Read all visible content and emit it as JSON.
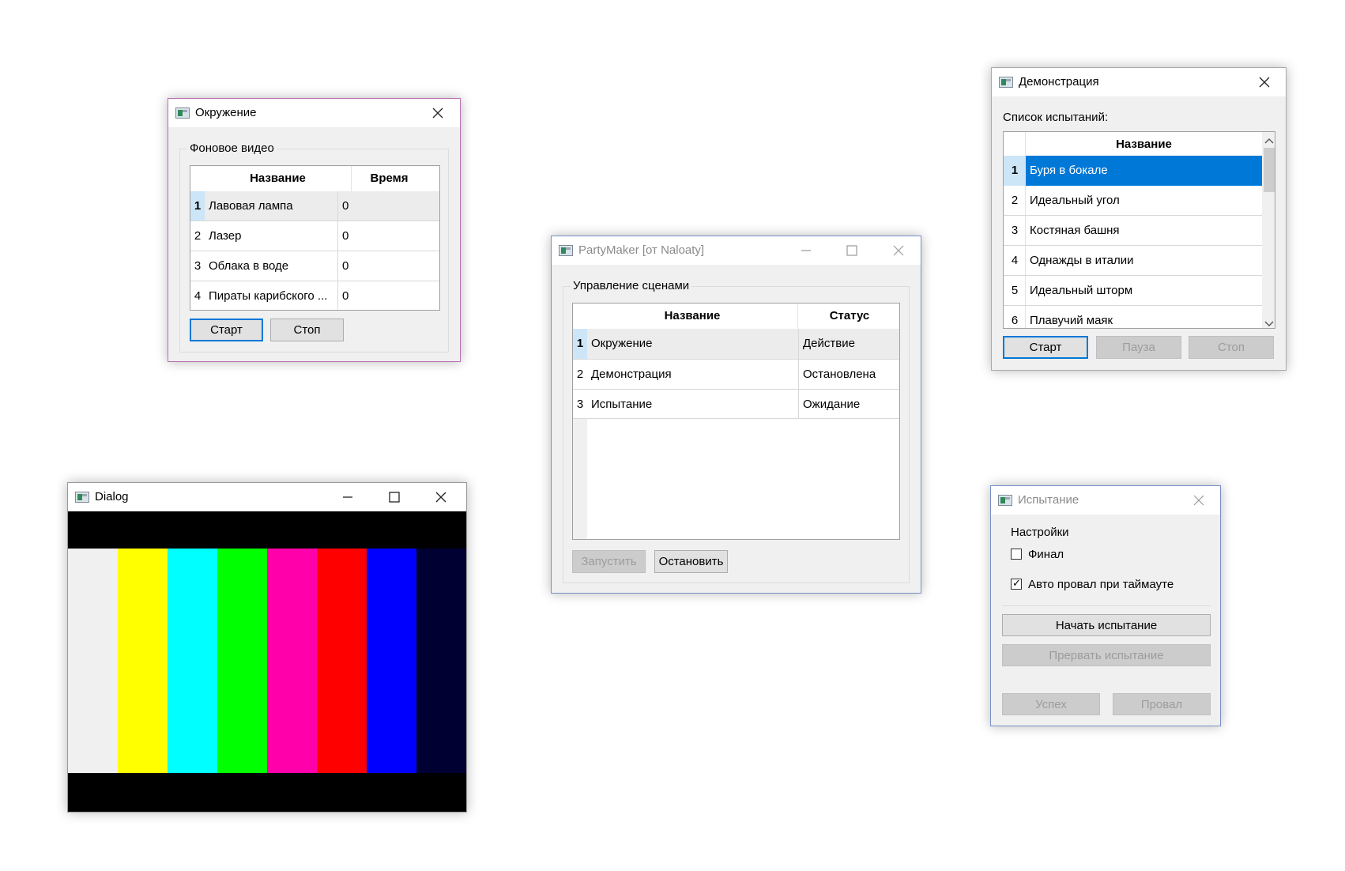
{
  "env_window": {
    "title": "Окружение",
    "group": "Фоновое видео",
    "col_name": "Название",
    "col_time": "Время",
    "rows": [
      {
        "n": "1",
        "name": "Лавовая лампа",
        "time": "0"
      },
      {
        "n": "2",
        "name": "Лазер",
        "time": "0"
      },
      {
        "n": "3",
        "name": "Облака в воде",
        "time": "0"
      },
      {
        "n": "4",
        "name": "Пираты карибского ...",
        "time": "0"
      }
    ],
    "start": "Старт",
    "stop": "Стоп"
  },
  "main_window": {
    "title": "PartyMaker [от Naloaty]",
    "group": "Управление сценами",
    "col_name": "Название",
    "col_status": "Статус",
    "rows": [
      {
        "n": "1",
        "name": "Окружение",
        "status": "Действие"
      },
      {
        "n": "2",
        "name": "Демонстрация",
        "status": "Остановлена"
      },
      {
        "n": "3",
        "name": "Испытание",
        "status": "Ожидание"
      }
    ],
    "run": "Запустить",
    "stop": "Остановить"
  },
  "demo_window": {
    "title": "Демонстрация",
    "list_label": "Список испытаний:",
    "col_name": "Название",
    "rows": [
      {
        "n": "1",
        "name": "Буря в бокале"
      },
      {
        "n": "2",
        "name": "Идеальный угол"
      },
      {
        "n": "3",
        "name": "Костяная башня"
      },
      {
        "n": "4",
        "name": "Однажды в италии"
      },
      {
        "n": "5",
        "name": "Идеальный шторм"
      },
      {
        "n": "6",
        "name": "Плавучий маяк"
      }
    ],
    "start": "Старт",
    "pause": "Пауза",
    "stop": "Стоп"
  },
  "dialog_window": {
    "title": "Dialog",
    "bars": [
      "#f0f0f0",
      "#ffff00",
      "#00ffff",
      "#00ff00",
      "#ff00aa",
      "#ff0000",
      "#0000ff",
      "#000033"
    ]
  },
  "test_window": {
    "title": "Испытание",
    "group": "Настройки",
    "opt_final": "Финал",
    "opt_final_checked": false,
    "opt_auto": "Авто провал при таймауте",
    "opt_auto_checked": true,
    "begin": "Начать испытание",
    "abort": "Прервать испытание",
    "success": "Успех",
    "fail": "Провал"
  }
}
